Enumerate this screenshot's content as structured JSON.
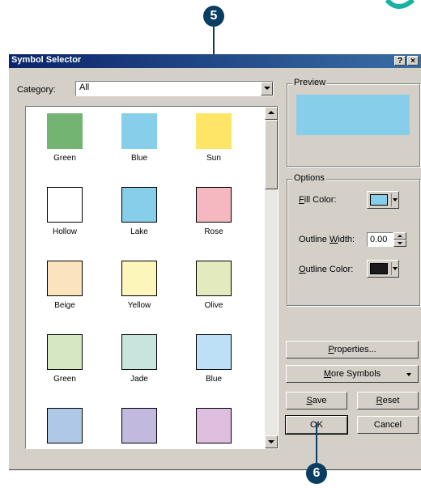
{
  "callouts": {
    "top": "5",
    "bottom": "6"
  },
  "dialog": {
    "title": "Symbol Selector",
    "help_button": "?",
    "close_button": "×"
  },
  "category": {
    "label": "Category:",
    "value": "All"
  },
  "symbols": [
    {
      "name": "Green",
      "color": "#73b473",
      "bordered": false
    },
    {
      "name": "Blue",
      "color": "#87ceeb",
      "bordered": false
    },
    {
      "name": "Sun",
      "color": "#ffe566",
      "bordered": false
    },
    {
      "name": "Hollow",
      "color": "#ffffff",
      "bordered": true
    },
    {
      "name": "Lake",
      "color": "#87ceeb",
      "bordered": true
    },
    {
      "name": "Rose",
      "color": "#f5b8c0",
      "bordered": true
    },
    {
      "name": "Beige",
      "color": "#fbe3bd",
      "bordered": true
    },
    {
      "name": "Yellow",
      "color": "#fdf6bb",
      "bordered": true
    },
    {
      "name": "Olive",
      "color": "#e3ebbe",
      "bordered": true
    },
    {
      "name": "Green",
      "color": "#d5e8c3",
      "bordered": true
    },
    {
      "name": "Jade",
      "color": "#c8e5dd",
      "bordered": true
    },
    {
      "name": "Blue",
      "color": "#bde0f6",
      "bordered": true
    },
    {
      "name": "",
      "color": "#b0c8e8",
      "bordered": true
    },
    {
      "name": "",
      "color": "#c2b9de",
      "bordered": true
    },
    {
      "name": "",
      "color": "#dfbfdf",
      "bordered": true
    }
  ],
  "preview": {
    "label": "Preview",
    "color": "#87ceeb"
  },
  "options": {
    "label": "Options",
    "fill_color_key": "F",
    "fill_color_rest": "ill Color:",
    "fill_color_value": "#87ceeb",
    "outline_width_pre": "Outline ",
    "outline_width_key": "W",
    "outline_width_post": "idth:",
    "outline_width_value": "0.00",
    "outline_color_key": "O",
    "outline_color_rest": "utline Color:",
    "outline_color_value": "#1a1a1a"
  },
  "buttons": {
    "properties_key": "P",
    "properties_rest": "roperties...",
    "more_symbols_key": "M",
    "more_symbols_rest": "ore Symbols",
    "save_key": "S",
    "save_rest": "ave",
    "reset_key": "R",
    "reset_rest": "eset",
    "ok": "OK",
    "cancel": "Cancel"
  }
}
